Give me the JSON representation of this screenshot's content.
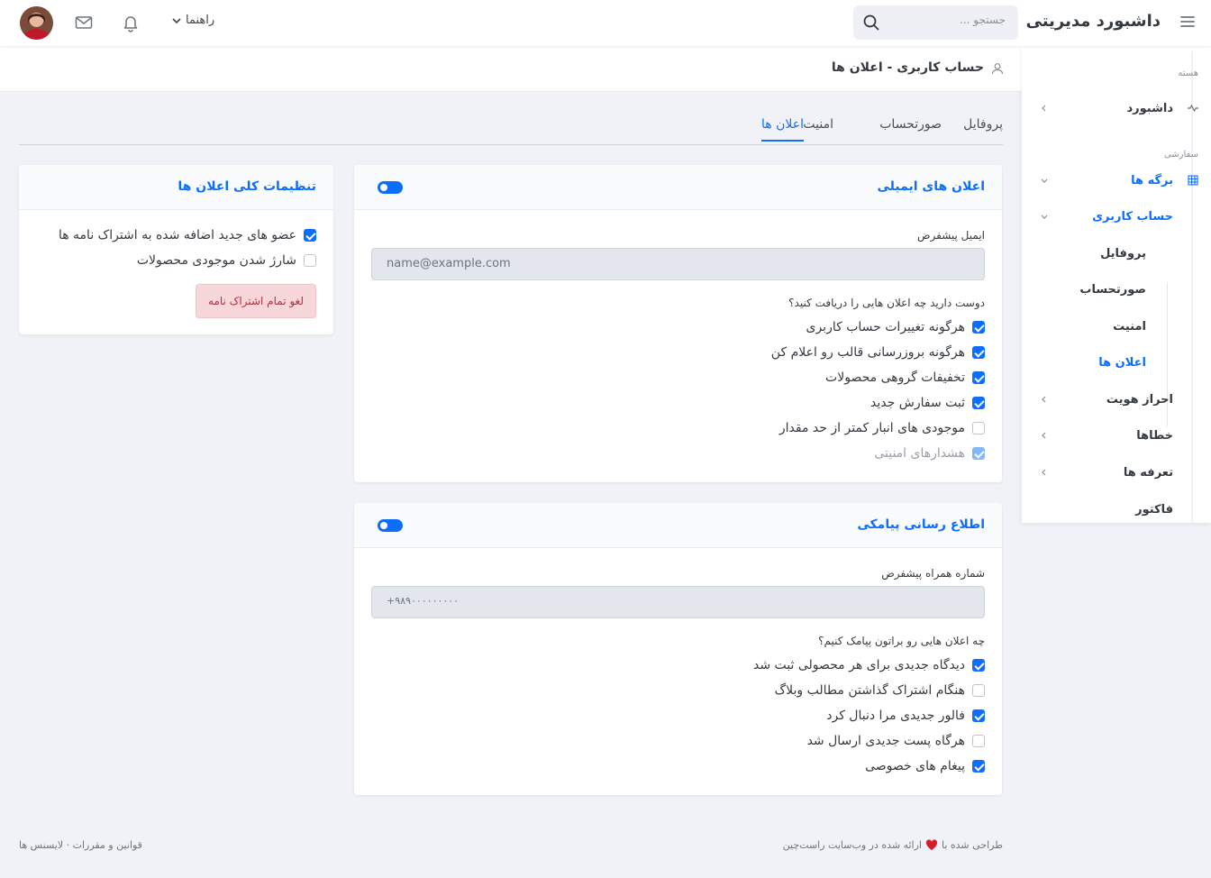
{
  "topbar": {
    "brand": "داشبورد مدیریتی",
    "search_placeholder": "جستجو ...",
    "help_label": "راهنما"
  },
  "sidebar": {
    "section_core": "هسته",
    "dashboard": "داشبورد",
    "section_custom": "سفارشی",
    "pages": "برگه ها",
    "account": "حساب کاربری",
    "sub_items": [
      "پروفایل",
      "صورتحساب",
      "امنیت",
      "اعلان ها"
    ],
    "auth": "احراز هویت",
    "errors": "خطاها",
    "pricing": "تعرفه ها",
    "invoice": "فاکتور"
  },
  "page": {
    "title": "حساب کاربری - اعلان ها"
  },
  "tabs": [
    "پروفایل",
    "صورتحساب",
    "امنیت",
    "اعلان ها"
  ],
  "email_card": {
    "title": "اعلان های ایمیلی",
    "default_email_label": "ایمیل پیشفرض",
    "default_email_value": "name@example.com",
    "question": "دوست دارید چه اعلان هایی را دریافت کنید؟",
    "options": [
      {
        "label": "هرگونه تغییرات حساب کاربری",
        "checked": true
      },
      {
        "label": "هرگونه بروزرسانی قالب رو اعلام کن",
        "checked": true
      },
      {
        "label": "تخفیفات گروهی محصولات",
        "checked": true
      },
      {
        "label": "ثبت سفارش جدید",
        "checked": true
      },
      {
        "label": "موجودی های انبار کمتر از حد مقدار",
        "checked": false
      },
      {
        "label": "هشدارهای امنیتی",
        "checked": true,
        "disabled": true
      }
    ]
  },
  "sms_card": {
    "title": "اطلاع رسانی پیامکی",
    "phone_label": "شماره همراه پیشفرض",
    "phone_value": "+۹۸۹۰۰۰۰۰۰۰۰۰",
    "question": "چه اعلان هایی رو براتون پیامک کنیم؟",
    "options": [
      {
        "label": "دیدگاه جدیدی برای هر محصولی ثبت شد",
        "checked": true
      },
      {
        "label": "هنگام اشتراک گذاشتن مطالب وبلاگ",
        "checked": false
      },
      {
        "label": "فالور جدیدی مرا دنبال کرد",
        "checked": true
      },
      {
        "label": "هرگاه پست جدیدی ارسال شد",
        "checked": false
      },
      {
        "label": "پیغام های خصوصی",
        "checked": true
      }
    ]
  },
  "general_card": {
    "title": "تنظیمات کلی اعلان ها",
    "options": [
      {
        "label": "عضو های جدید اضافه شده به اشتراک نامه ها",
        "checked": true
      },
      {
        "label": "شارژ شدن موجودی محصولات",
        "checked": false
      }
    ],
    "unsubscribe_label": "لغو تمام اشتراک نامه"
  },
  "footer": {
    "credit_before": "طراحی شده با",
    "credit_after": "ارائه شده در وب‌سایت راست‌چین",
    "links": "قوانین و مقررات · لایسنس ها"
  },
  "colors": {
    "accent": "#0d6efd",
    "danger": "#c2293a",
    "background": "#f0f2f7"
  },
  "icons": [
    "menu-icon",
    "search-icon",
    "chevron-down-icon",
    "bell-icon",
    "mail-icon",
    "activity-icon",
    "grid-icon",
    "chevron-left-icon",
    "user-icon",
    "heart-icon"
  ]
}
